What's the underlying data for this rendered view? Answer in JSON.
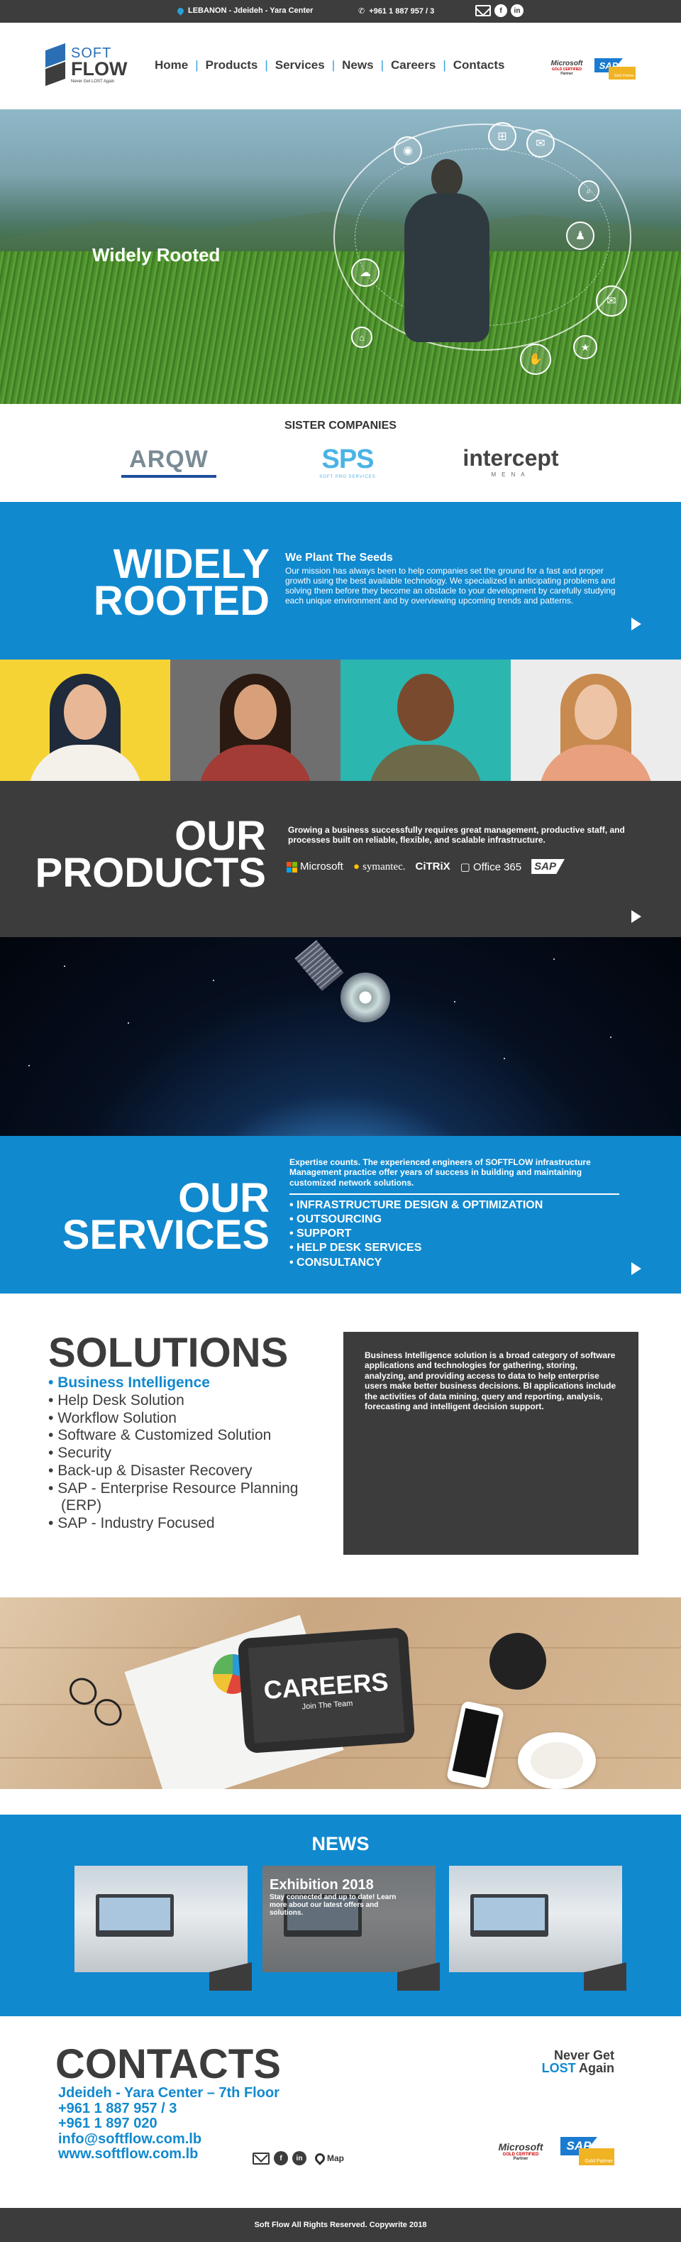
{
  "topbar": {
    "location": "LEBANON - Jdeideh - Yara Center",
    "phone": "+961 1 887 957 / 3",
    "social": [
      "mail-icon",
      "facebook-icon",
      "linkedin-icon"
    ]
  },
  "logo": {
    "soft": "SOFT",
    "flow": "FLOW",
    "tagline": "Never Get LOST Again"
  },
  "nav": [
    "Home",
    "Products",
    "Services",
    "News",
    "Careers",
    "Contacts"
  ],
  "badges": {
    "ms": "Microsoft",
    "ms_sub": "GOLD CERTIFIED",
    "ms_partner": "Partner",
    "sap": "SAP",
    "sap_sub": "Gold Partner"
  },
  "hero": {
    "title": "Widely Rooted",
    "icons": [
      "wifi-icon",
      "cart-icon",
      "chat-icon",
      "search-icon",
      "user-icon",
      "cloud-icon",
      "mail-icon",
      "home-icon",
      "like-icon",
      "star-icon"
    ]
  },
  "sister": {
    "heading": "SISTER COMPANIES",
    "logos": [
      {
        "name": "ARQW",
        "sub": ""
      },
      {
        "name": "SPS",
        "sub": "SOFT PRO SERVICES"
      },
      {
        "name": "intercept",
        "sub": "MENA"
      }
    ]
  },
  "rooted": {
    "line1": "WIDELY",
    "line2": "ROOTED",
    "subtitle": "We Plant The Seeds",
    "body": "Our mission has always been to help companies set the ground for a fast and proper growth using the best available technology. We specialized in anticipating problems and solving them before they become an obstacle to your development by carefully studying each unique environment and by overviewing upcoming trends and patterns."
  },
  "people_colors": [
    "#f5d335",
    "#6f6f70",
    "#2bb6b0",
    "#ececec"
  ],
  "products": {
    "line1": "OUR",
    "line2": "PRODUCTS",
    "body": "Growing a business successfully requires great management, productive staff, and processes built on reliable, flexible, and scalable infrastructure.",
    "vendors": [
      "Microsoft",
      "symantec.",
      "CiTRiX",
      "Office 365",
      "SAP"
    ]
  },
  "services": {
    "line1": "OUR",
    "line2": "SERVICES",
    "body": "Expertise counts. The experienced engineers of SOFTFLOW infrastructure Management practice offer years of success in building and maintaining customized network solutions.",
    "items": [
      "INFRASTRUCTURE DESIGN & OPTIMIZATION",
      "OUTSOURCING",
      "SUPPORT",
      "HELP DESK SERVICES",
      "CONSULTANCY"
    ]
  },
  "solutions": {
    "title": "SOLUTIONS",
    "items": [
      "Business Intelligence",
      "Help Desk Solution",
      "Workflow Solution",
      "Software & Customized Solution",
      "Security",
      "Back-up & Disaster Recovery",
      "SAP - Enterprise Resource Planning (ERP)",
      "SAP - Industry Focused"
    ],
    "active_index": 0,
    "description": "Business Intelligence solution is a broad category of software applications and technologies for gathering, storing, analyzing, and providing access to data to help enterprise users make better business decisions. BI applications include the activities of data mining, query and reporting, analysis, forecasting and intelligent decision support."
  },
  "careers": {
    "title": "CAREERS",
    "subtitle": "Join The Team"
  },
  "news": {
    "title": "NEWS",
    "cards": [
      {
        "title": "",
        "desc": ""
      },
      {
        "title": "Exhibition 2018",
        "desc": "Stay connected and up to date! Learn more about our latest offers and solutions."
      },
      {
        "title": "",
        "desc": ""
      }
    ]
  },
  "contacts": {
    "title": "CONTACTS",
    "address": "Jdeideh - Yara Center – 7th Floor",
    "phone1": "+961 1 887 957 / 3",
    "phone2": "+961 1 897 020",
    "email": "info@softflow.com.lb",
    "website": "www.softflow.com.lb",
    "map_label": "Map",
    "slogan_line1": "Never Get",
    "slogan_lost": "LOST",
    "slogan_line2": "Again"
  },
  "footer": {
    "text": "Soft Flow All Rights Reserved. Copywrite 2018"
  },
  "colors": {
    "brand_blue": "#1189cf",
    "dark": "#3d3c3d"
  }
}
